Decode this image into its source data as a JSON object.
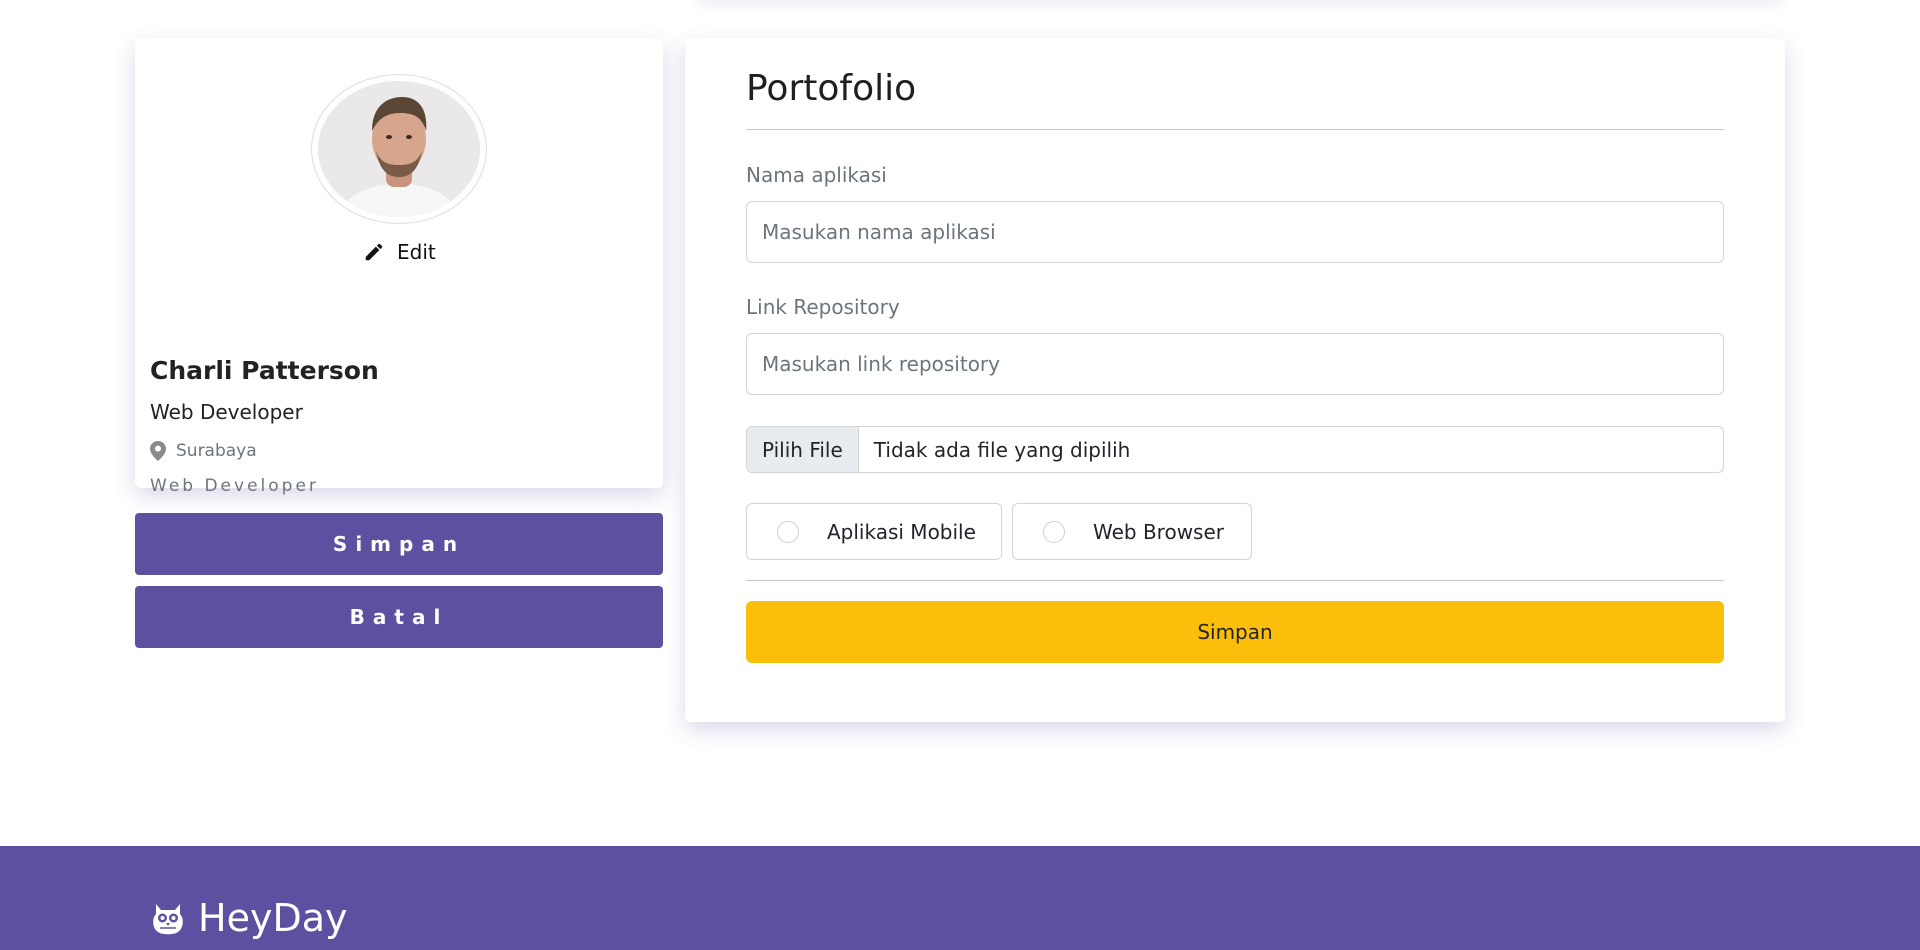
{
  "profile": {
    "name": "Charli Patterson",
    "role": "Web Developer",
    "city": "Surabaya",
    "job": "Web Developer",
    "edit_label": "Edit",
    "avatar_icon": "user-photo"
  },
  "actions": {
    "save_label": "Simpan",
    "cancel_label": "Batal"
  },
  "portfolio": {
    "title": "Portofolio",
    "app_name": {
      "label": "Nama aplikasi",
      "placeholder": "Masukan nama aplikasi",
      "value": ""
    },
    "repo_link": {
      "label": "Link Repository",
      "placeholder": "Masukan link repository",
      "value": ""
    },
    "file": {
      "button_label": "Pilih File",
      "status": "Tidak ada file yang dipilih"
    },
    "type_options": [
      {
        "label": "Aplikasi Mobile",
        "checked": false
      },
      {
        "label": "Web Browser",
        "checked": false
      }
    ],
    "submit_label": "Simpan"
  },
  "footer": {
    "brand": "HeyDay",
    "logo_icon": "owl-logo-icon"
  },
  "colors": {
    "primary": "#5e50a1",
    "accent": "#fbbf0b",
    "muted_text": "#6c757d"
  }
}
